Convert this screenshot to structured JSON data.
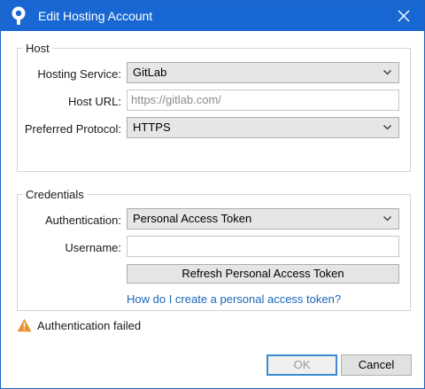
{
  "window": {
    "title": "Edit Hosting Account"
  },
  "host": {
    "legend": "Host",
    "hosting_service_label": "Hosting Service:",
    "hosting_service_value": "GitLab",
    "host_url_label": "Host URL:",
    "host_url_placeholder": "https://gitlab.com/",
    "host_url_value": "",
    "protocol_label": "Preferred Protocol:",
    "protocol_value": "HTTPS"
  },
  "credentials": {
    "legend": "Credentials",
    "auth_label": "Authentication:",
    "auth_value": "Personal Access Token",
    "username_label": "Username:",
    "username_value": "",
    "refresh_button": "Refresh Personal Access Token",
    "help_link": "How do I create a personal access token?"
  },
  "status": {
    "message": "Authentication failed",
    "icon": "warning-icon",
    "color": "#e8912d"
  },
  "buttons": {
    "ok": "OK",
    "cancel": "Cancel"
  },
  "colors": {
    "titlebar": "#1967d2",
    "link": "#1c66b8"
  }
}
